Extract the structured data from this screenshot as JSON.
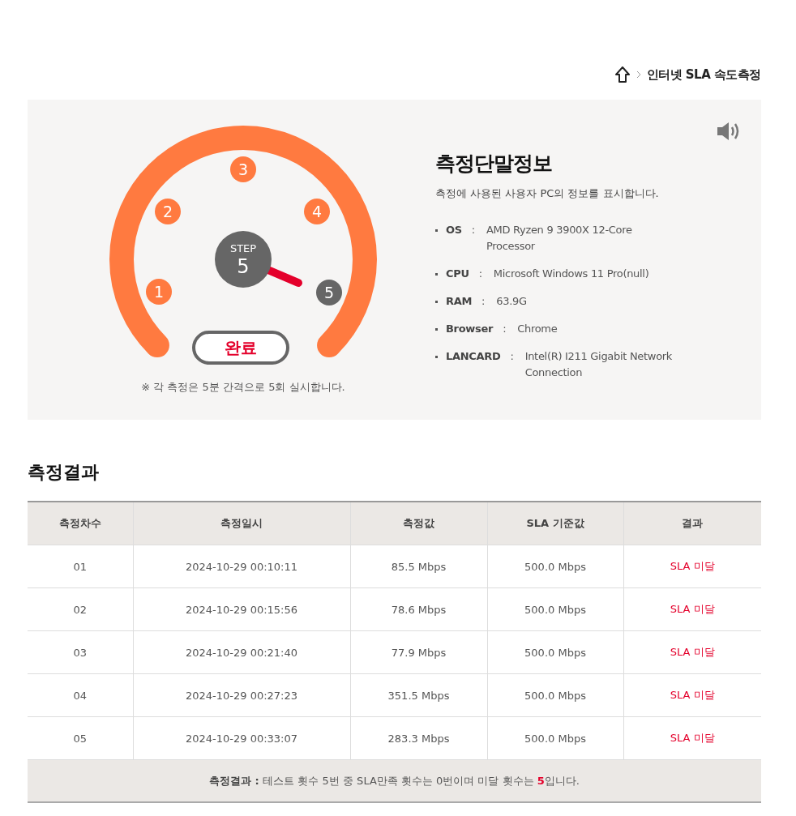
{
  "breadcrumb": {
    "current": "인터넷 SLA 속도측정"
  },
  "gauge": {
    "step_label": "STEP",
    "step_value": "5",
    "status": "완료",
    "note": "※ 각 측정은 5분 간격으로 5회 실시합니다.",
    "steps": [
      {
        "label": "1",
        "selected": false
      },
      {
        "label": "2",
        "selected": false
      },
      {
        "label": "3",
        "selected": false
      },
      {
        "label": "4",
        "selected": false
      },
      {
        "label": "5",
        "selected": true
      }
    ]
  },
  "device_info": {
    "title": "측정단말정보",
    "subtitle": "측정에 사용된 사용자 PC의 정보를 표시합니다.",
    "items": [
      {
        "label": "OS",
        "separator": ":",
        "value": "AMD Ryzen 9 3900X 12-Core Processor"
      },
      {
        "label": "CPU",
        "separator": ":",
        "value": "Microsoft Windows 11 Pro(null)"
      },
      {
        "label": "RAM",
        "separator": ":",
        "value": "63.9G"
      },
      {
        "label": "Browser",
        "separator": ":",
        "value": "Chrome"
      },
      {
        "label": "LANCARD",
        "separator": ":",
        "value": "Intel(R) I211 Gigabit Network Connection"
      }
    ]
  },
  "results": {
    "title": "측정결과",
    "columns": [
      "측정차수",
      "측정일시",
      "측정값",
      "SLA 기준값",
      "결과"
    ],
    "rows": [
      [
        "01",
        "2024-10-29 00:10:11",
        "85.5 Mbps",
        "500.0 Mbps",
        "SLA 미달"
      ],
      [
        "02",
        "2024-10-29 00:15:56",
        "78.6 Mbps",
        "500.0 Mbps",
        "SLA 미달"
      ],
      [
        "03",
        "2024-10-29 00:21:40",
        "77.9 Mbps",
        "500.0 Mbps",
        "SLA 미달"
      ],
      [
        "04",
        "2024-10-29 00:27:23",
        "351.5 Mbps",
        "500.0 Mbps",
        "SLA 미달"
      ],
      [
        "05",
        "2024-10-29 00:33:07",
        "283.3 Mbps",
        "500.0 Mbps",
        "SLA 미달"
      ]
    ],
    "summary": [
      {
        "text": "측정결과 : ",
        "kind": "label"
      },
      {
        "text": "테스트 횟수 ",
        "kind": "plain"
      },
      {
        "text": "5",
        "kind": "number"
      },
      {
        "text": "번 중 SLA만족 횟수는 ",
        "kind": "plain"
      },
      {
        "text": "0",
        "kind": "number"
      },
      {
        "text": "번이며 미달 횟수는 ",
        "kind": "plain"
      },
      {
        "text": "5",
        "kind": "alert"
      },
      {
        "text": "입니다.",
        "kind": "plain"
      }
    ]
  }
}
